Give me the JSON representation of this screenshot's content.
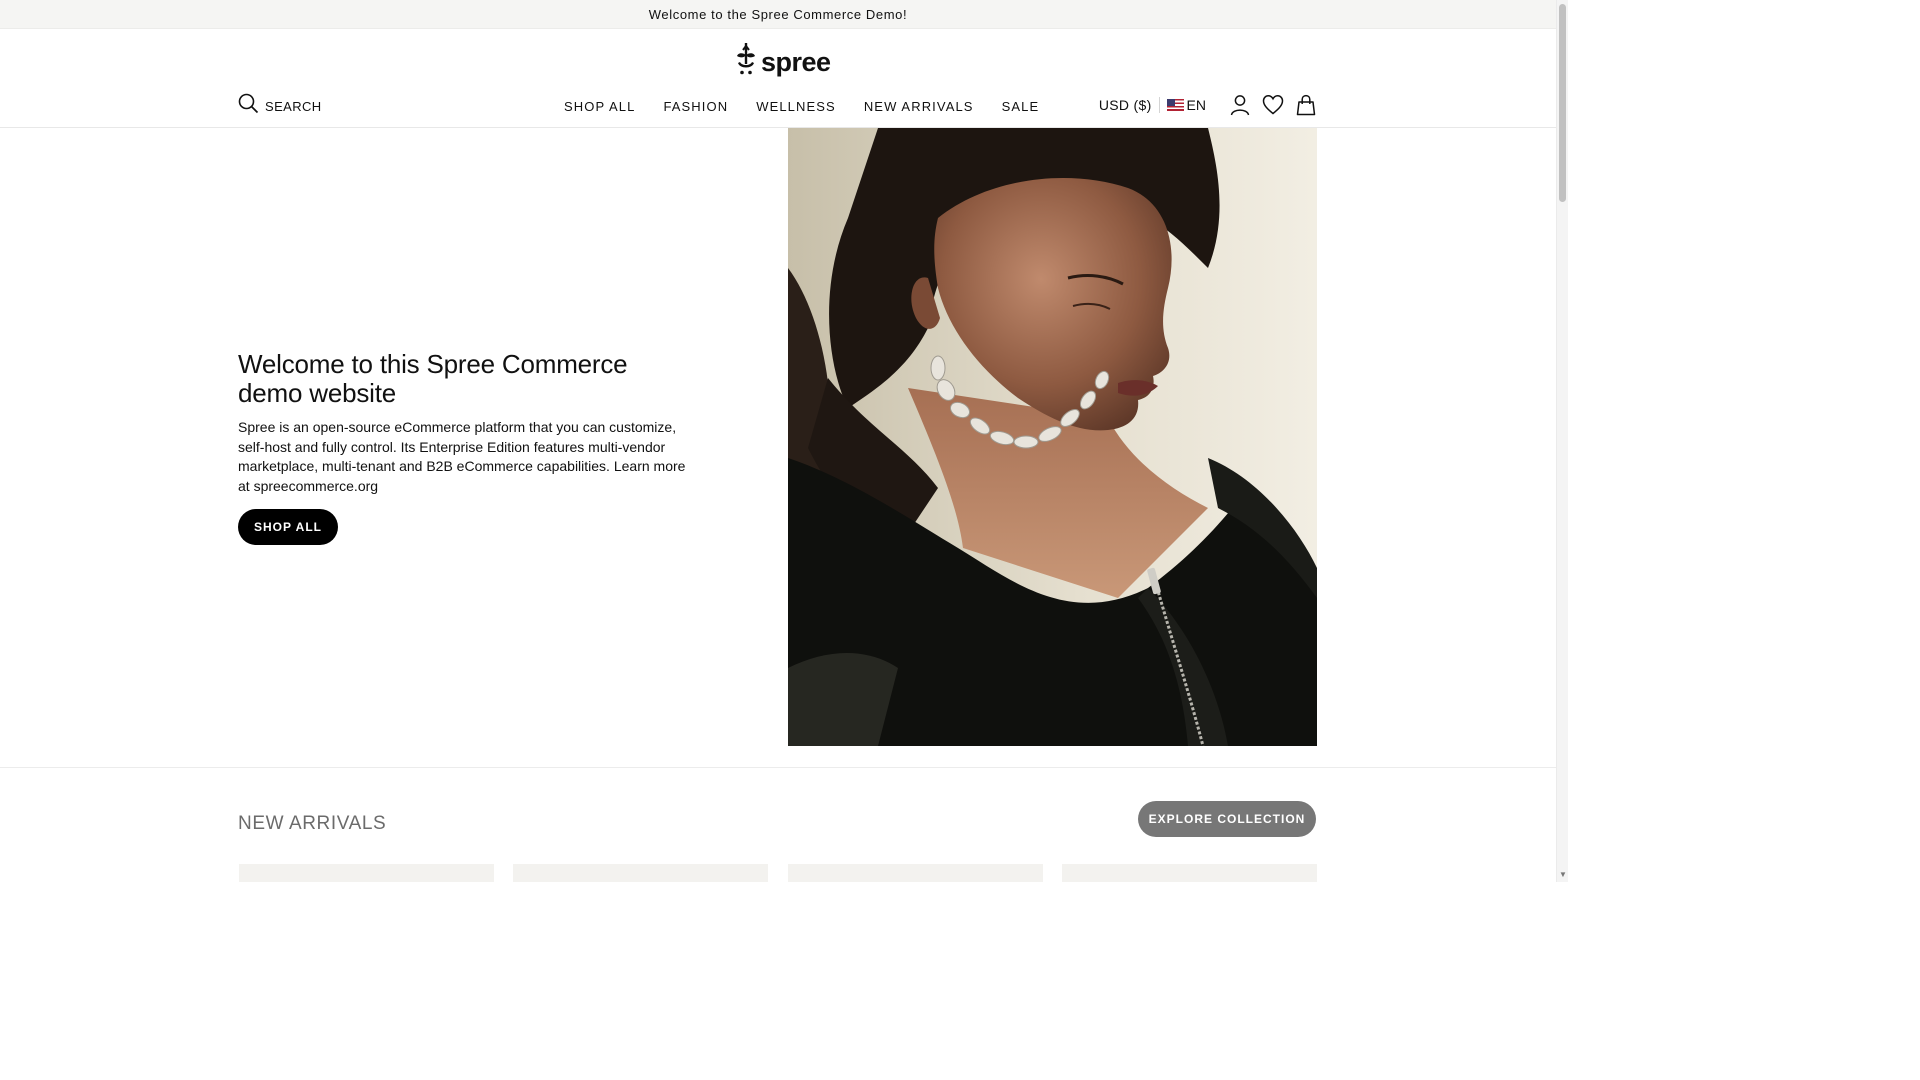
{
  "announcement": {
    "text": "Welcome to the Spree Commerce Demo!"
  },
  "header": {
    "logo_text": "spree",
    "search_label": "SEARCH",
    "nav": [
      {
        "label": "SHOP ALL"
      },
      {
        "label": "FASHION"
      },
      {
        "label": "WELLNESS"
      },
      {
        "label": "NEW ARRIVALS"
      },
      {
        "label": "SALE"
      }
    ],
    "currency": "USD ($)",
    "language": "EN",
    "icons": [
      "search-icon",
      "user-icon",
      "heart-icon",
      "bag-icon",
      "flag-us-icon"
    ]
  },
  "hero": {
    "title": "Welcome to this Spree Commerce demo website",
    "body": "Spree is an open-source eCommerce platform that you can customize, self-host and fully control. Its Enterprise Edition features multi-vendor marketplace, multi-tenant and B2B eCommerce capabilities. Learn more at spreecommerce.org",
    "cta_label": "SHOP ALL"
  },
  "new_arrivals": {
    "title": "NEW ARRIVALS",
    "cta_label": "EXPLORE COLLECTION"
  },
  "colors": {
    "primary_button": "#000000",
    "secondary_button": "#777777",
    "announcement_bg": "#f5f5f3"
  }
}
